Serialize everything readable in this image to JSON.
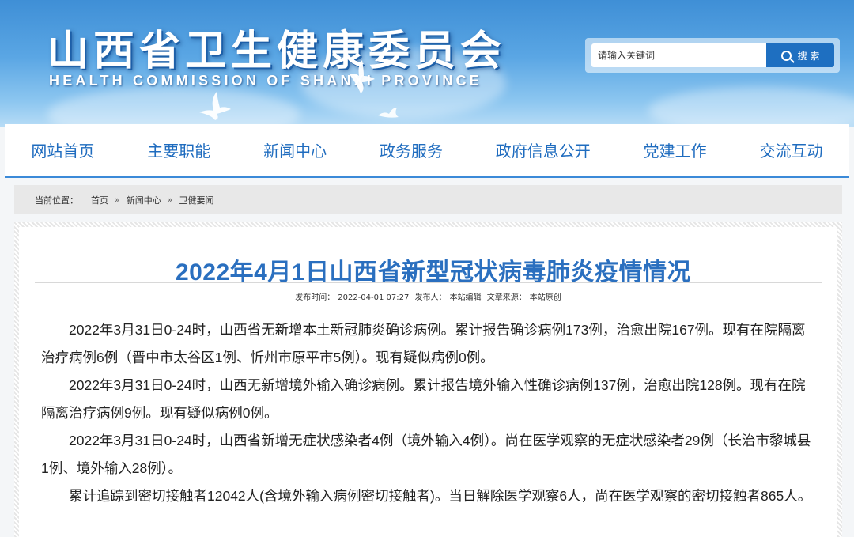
{
  "header": {
    "title_cn": "山西省卫生健康委员会",
    "title_en": "HEALTH COMMISSION OF SHANXI PROVINCE",
    "search": {
      "placeholder": "请输入关键词",
      "button_label": "搜 索",
      "icon": "search-icon"
    }
  },
  "nav": {
    "items": [
      {
        "label": "网站首页"
      },
      {
        "label": "主要职能"
      },
      {
        "label": "新闻中心"
      },
      {
        "label": "政务服务"
      },
      {
        "label": "政府信息公开"
      },
      {
        "label": "党建工作"
      },
      {
        "label": "交流互动"
      }
    ]
  },
  "breadcrumb": {
    "prefix": "当前位置：",
    "items": [
      "首页",
      "新闻中心",
      "卫健要闻"
    ],
    "separator": "»"
  },
  "article": {
    "title": "2022年4月1日山西省新型冠状病毒肺炎疫情情况",
    "meta": {
      "publish_label": "发布时间：",
      "publish_time": "2022-04-01 07:27",
      "author_label": "发布人：",
      "author": "本站编辑",
      "source_label": "文章来源：",
      "source": "本站原创"
    },
    "paragraphs": [
      "2022年3月31日0-24时，山西省无新增本土新冠肺炎确诊病例。累计报告确诊病例173例，治愈出院167例。现有在院隔离治疗病例6例（晋中市太谷区1例、忻州市原平市5例）。现有疑似病例0例。",
      "2022年3月31日0-24时，山西无新增境外输入确诊病例。累计报告境外输入性确诊病例137例，治愈出院128例。现有在院隔离治疗病例9例。现有疑似病例0例。",
      "2022年3月31日0-24时，山西省新增无症状感染者4例（境外输入4例）。尚在医学观察的无症状感染者29例（长治市黎城县1例、境外输入28例）。",
      "累计追踪到密切接触者12042人(含境外输入病例密切接触者)。当日解除医学观察6人，尚在医学观察的密切接触者865人。"
    ]
  },
  "colors": {
    "brand_blue": "#2a6fbf",
    "nav_text": "#1f6cbf",
    "search_button": "#1e6fc1"
  }
}
